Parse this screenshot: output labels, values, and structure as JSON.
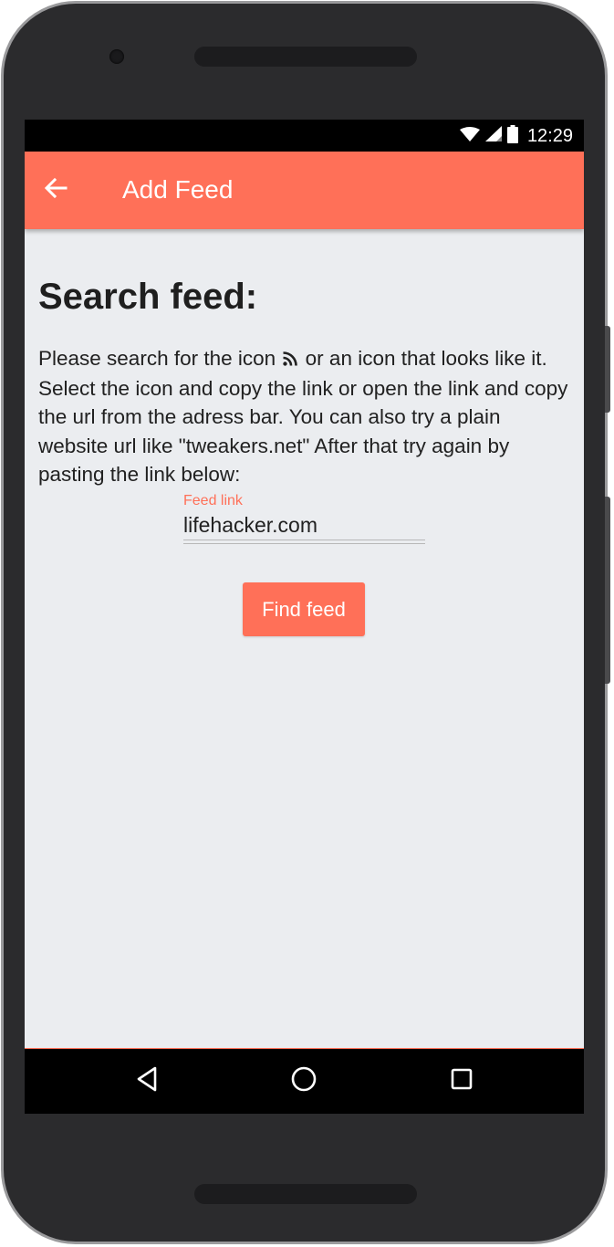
{
  "status_bar": {
    "time": "12:29"
  },
  "app_bar": {
    "title": "Add Feed",
    "back_icon": "arrow-back-icon",
    "color": "#ff7058"
  },
  "content": {
    "heading": "Search feed:",
    "instructions_before_icon": "Please search for the icon",
    "instructions_icon": "rss-icon",
    "instructions_after_icon": " or an icon that looks like it. Select the icon and copy the link or open the link and copy the url from the adress bar. You can also try a plain website url like \"tweakers.net\" After that try again by pasting the link below:"
  },
  "feed_input": {
    "label": "Feed link",
    "value": "lifehacker.com"
  },
  "find_button": {
    "label": "Find feed"
  },
  "nav_bar": {
    "back_icon": "triangle-back-icon",
    "home_icon": "circle-home-icon",
    "recents_icon": "square-recents-icon"
  },
  "colors": {
    "accent": "#ff7058",
    "background": "#ebedf0",
    "text": "#212121"
  }
}
